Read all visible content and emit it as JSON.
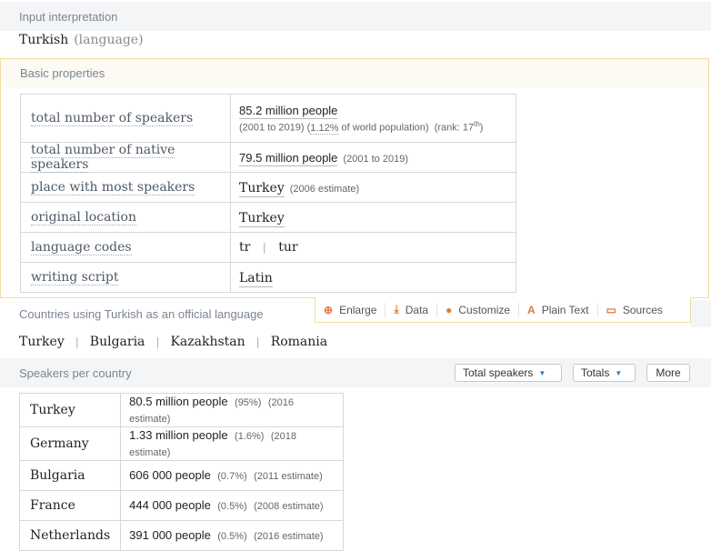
{
  "input_interpretation": {
    "header": "Input interpretation",
    "term": "Turkish",
    "qualifier": "(language)"
  },
  "basic_properties": {
    "header": "Basic properties",
    "rows": [
      {
        "key": "total number of speakers",
        "value": "85.2",
        "unit": " million people",
        "detail_range": "(2001 to 2019)",
        "detail_pct": "1.12%",
        "detail_pct_suffix": " of world population)",
        "detail_rank": "(rank: 17",
        "detail_rank_sup": "th",
        "detail_rank_end": ")"
      },
      {
        "key": "total number of native speakers",
        "value": "79.5",
        "unit": " million people",
        "note": "(2001 to 2019)"
      },
      {
        "key": "place with most speakers",
        "value": "Turkey",
        "note": "(2006 estimate)"
      },
      {
        "key": "original location",
        "value": "Turkey"
      },
      {
        "key": "language codes",
        "value_a": "tr",
        "sep": "|",
        "value_b": "tur"
      },
      {
        "key": "writing script",
        "value": "Latin"
      }
    ]
  },
  "toolbar": {
    "items": [
      {
        "icon": "enlarge-icon",
        "glyph": "⊕",
        "label": "Enlarge"
      },
      {
        "icon": "download-icon",
        "glyph": "⤓",
        "label": "Data"
      },
      {
        "icon": "palette-icon",
        "glyph": "●",
        "label": "Customize"
      },
      {
        "icon": "plain-text-icon",
        "glyph": "A",
        "label": "Plain Text"
      },
      {
        "icon": "book-icon",
        "glyph": "▭",
        "label": "Sources"
      }
    ]
  },
  "official_countries": {
    "header": "Countries using Turkish as an official language",
    "items": [
      "Turkey",
      "Bulgaria",
      "Kazakhstan",
      "Romania"
    ],
    "sep": "|"
  },
  "speakers_per_country": {
    "header": "Speakers per country",
    "controls": {
      "metric": "Total speakers",
      "totals": "Totals",
      "more": "More"
    },
    "rows": [
      {
        "country": "Turkey",
        "value": "80.5",
        "unit": " million people",
        "pct": "(95%)",
        "note": "(2016 estimate)"
      },
      {
        "country": "Germany",
        "value": "1.33",
        "unit": " million people",
        "pct": "(1.6%)",
        "note": "(2018 estimate)"
      },
      {
        "country": "Bulgaria",
        "value": "606 000",
        "unit": " people",
        "pct": "(0.7%)",
        "note": "(2011 estimate)"
      },
      {
        "country": "France",
        "value": "444 000",
        "unit": " people",
        "pct": "(0.5%)",
        "note": "(2008 estimate)"
      },
      {
        "country": "Netherlands",
        "value": "391 000",
        "unit": " people",
        "pct": "(0.5%)",
        "note": "(2016 estimate)"
      }
    ]
  },
  "colors": {
    "pod_header_bg": "#f4f5f6",
    "pod_header_text": "#7a8592",
    "highlight_border": "#f1dca0",
    "tool_icon": "#e07a3a",
    "caret": "#2b7bbf"
  }
}
